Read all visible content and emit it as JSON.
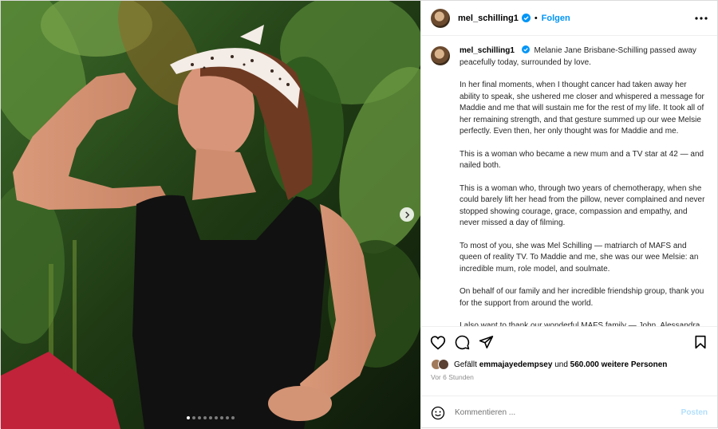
{
  "header": {
    "username": "mel_schilling1",
    "separator": "•",
    "follow_label": "Folgen"
  },
  "caption": {
    "username": "mel_schilling1",
    "paragraphs": [
      "Melanie Jane Brisbane-Schilling passed away peacefully today, surrounded by love.",
      "In her final moments, when I thought cancer had taken away her ability to speak, she ushered me closer and whispered a message for Maddie and me that will sustain me for the rest of my life. It took all of her remaining strength, and that gesture summed up our wee Melsie perfectly. Even then, her only thought was for Maddie and me.",
      "This is a woman who became a new mum and a TV star at 42 — and nailed both.",
      "This is a woman who, through two years of chemotherapy, when she could barely lift her head from the pillow, never complained and never stopped showing courage, grace, compassion and empathy, and never missed a day of filming.",
      "To most of you, she was Mel Schilling — matriarch of MAFS and queen of reality TV. To Maddie and me, she was our wee Melsie: an incredible mum, role model, and soulmate.",
      "On behalf of our family and her incredible friendship group, thank you for the support from around the world.",
      "I also want to thank our wonderful MAFS family — John, Alessandra, Charlene, Roxy, and Sophie — for your kindness and"
    ]
  },
  "likes": {
    "prefix": "Gefällt",
    "user": "emmajayedempsey",
    "middle": "und",
    "count": "560.000 weitere Personen"
  },
  "timestamp": "Vor 6 Stunden",
  "comment": {
    "placeholder": "Kommentieren ...",
    "post_label": "Posten"
  },
  "carousel": {
    "total_slides": 9,
    "active_index": 0
  },
  "colors": {
    "accent": "#0095f6",
    "verified": "#0095f6",
    "post_disabled": "#b2dffc",
    "headband": "#f4ece6",
    "top": "#111111"
  },
  "icons": [
    "verified-badge-icon",
    "more-options-icon",
    "heart-icon",
    "comment-icon",
    "share-icon",
    "bookmark-icon",
    "emoji-icon",
    "chevron-right-icon"
  ]
}
